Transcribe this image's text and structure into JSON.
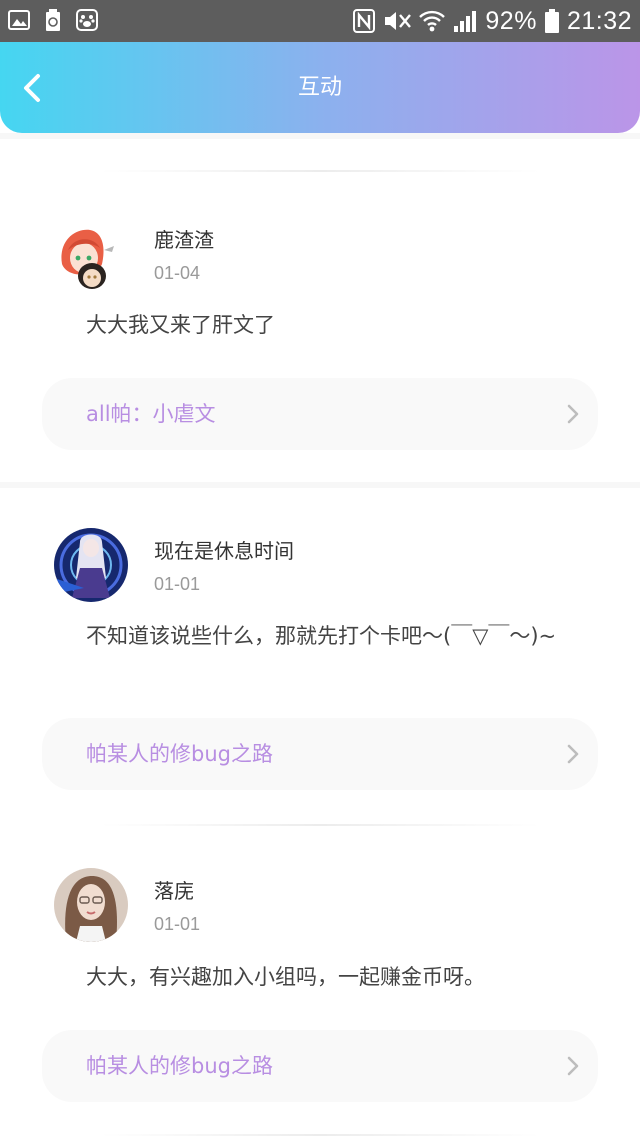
{
  "status_bar": {
    "battery": "92%",
    "time": "21:32",
    "icons_left": [
      "image-icon",
      "battery-saver-icon",
      "paw-icon"
    ],
    "icons_right": [
      "nfc-icon",
      "mute-icon",
      "wifi-icon",
      "signal-icon",
      "battery-icon"
    ]
  },
  "header": {
    "title": "互动",
    "gradient": [
      "#45d6f1",
      "#bb95e8"
    ]
  },
  "posts": [
    {
      "username": "鹿渣渣",
      "date": "01-04",
      "content": "大大我又来了肝文了",
      "link": "all帕：小虐文"
    },
    {
      "username": "现在是休息时间",
      "date": "01-01",
      "content": "不知道该说些什么，那就先打个卡吧～(￣▽￣～)~",
      "link": "帕某人的修bug之路"
    },
    {
      "username": "落庑",
      "date": "01-01",
      "content": "大大，有兴趣加入小组吗，一起赚金币呀。",
      "link": "帕某人的修bug之路"
    }
  ],
  "colors": {
    "link_text": "#b88ee2",
    "date_text": "#9a9a9a"
  }
}
